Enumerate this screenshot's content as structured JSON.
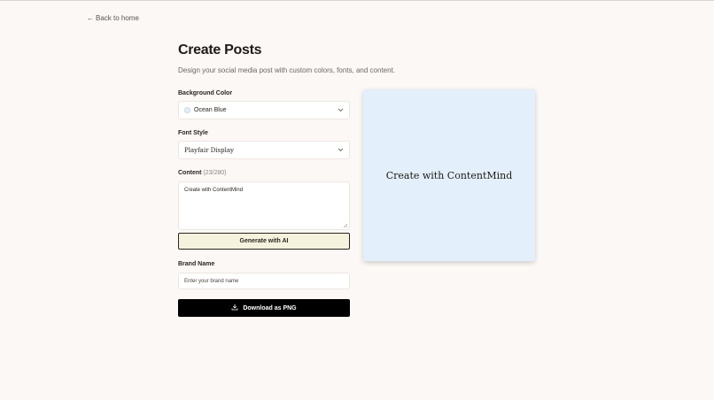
{
  "nav": {
    "back_label": "Back to home",
    "back_arrow": "←"
  },
  "header": {
    "title": "Create Posts",
    "subtitle": "Design your social media post with custom colors, fonts, and content."
  },
  "form": {
    "background_color": {
      "label": "Background Color",
      "value": "Ocean Blue",
      "swatch": "#e3effa"
    },
    "font_style": {
      "label": "Font Style",
      "value": "Playfair Display"
    },
    "content": {
      "label": "Content",
      "count": "(23/280)",
      "value": "Create with ContentMind"
    },
    "generate_button": "Generate with AI",
    "brand_name": {
      "label": "Brand Name",
      "placeholder": "Enter your brand name"
    },
    "download_button": "Download as PNG"
  },
  "preview": {
    "text": "Create with ContentMind",
    "background": "#e3effa"
  }
}
